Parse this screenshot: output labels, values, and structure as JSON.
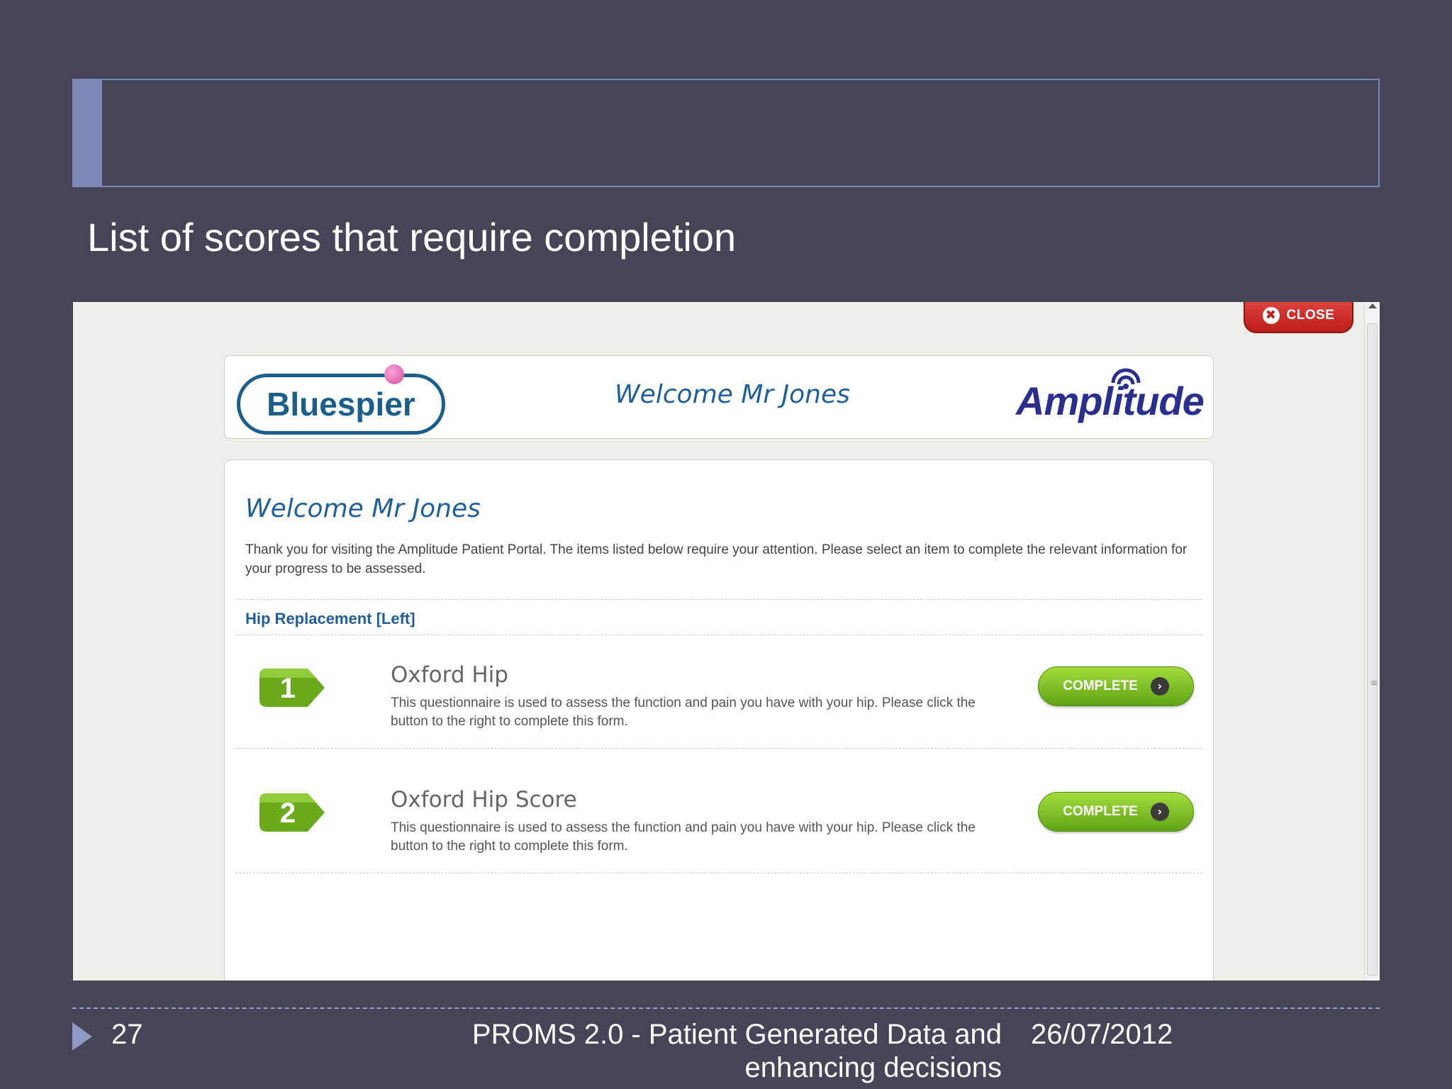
{
  "slide": {
    "heading": "List of  scores that require completion",
    "footer": {
      "page_number": "27",
      "title": "PROMS 2.0 - Patient Generated Data and enhancing decisions",
      "date": "26/07/2012"
    }
  },
  "window": {
    "close_label": "CLOSE"
  },
  "portal": {
    "bluespier_logo": "Bluespier",
    "header_welcome": "Welcome Mr Jones",
    "amplitude_logo": "Amplitude",
    "welcome": "Welcome Mr Jones",
    "intro": "Thank you for visiting the Amplitude Patient Portal. The items listed below require your attention. Please select an item to complete the relevant information for your progress to be assessed.",
    "section_title": "Hip Replacement [Left]",
    "items": [
      {
        "number": "1",
        "title": "Oxford Hip",
        "description": "This questionnaire is used to assess the function and pain you have with your hip. Please click the button to the right to complete this form.",
        "button_label": "COMPLETE"
      },
      {
        "number": "2",
        "title": "Oxford Hip Score",
        "description": "This questionnaire is used to assess the function and pain you have with your hip. Please click the button to the right to complete this form.",
        "button_label": "COMPLETE"
      }
    ]
  },
  "colors": {
    "slide_background": "#464456",
    "accent": "#7c86b4",
    "brand_blue": "#1f5f9a",
    "button_green": "#7cc22a",
    "close_red": "#c92a24"
  },
  "icons": {
    "close": "close-x-icon",
    "arrow": "chevron-right-icon",
    "footer": "triangle-bullet-icon"
  }
}
